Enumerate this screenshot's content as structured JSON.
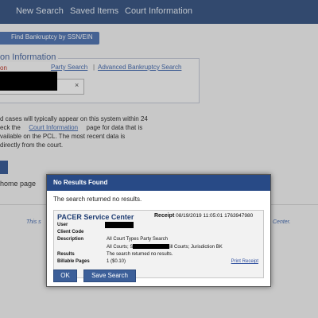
{
  "nav": {
    "items": [
      "New Search",
      "Saved Items",
      "Court Information"
    ]
  },
  "subbar": {
    "label": "Find Bankruptcy by SSN/EIN"
  },
  "panel": {
    "title": "on Information",
    "red_label": "on",
    "party_search": "Party Search",
    "separator": "|",
    "advanced_search": "Advanced Bankruptcy Search",
    "clear": "×"
  },
  "info": {
    "line1": "d cases will typically appear on this system within 24",
    "line2_pre": "eck the",
    "court_info": "Court Information",
    "line2_post": "page for data that is",
    "line3": "vailable on the PCL. The most recent data is",
    "line4": "directly from the court."
  },
  "home": "home page",
  "footer": {
    "left": "This s",
    "right": "Center."
  },
  "modal": {
    "title": "No Results Found",
    "message": "The search returned no results.",
    "receipt": {
      "center": "PACER Service Center",
      "receipt_label": "Receipt",
      "datetime": "08/19/2019 11:05:01",
      "number": "1763947980",
      "user_label": "User",
      "client_code_label": "Client Code",
      "description_label": "Description",
      "description": "All Court Types Party Search",
      "description_line2_pre": "All Courts; S",
      "description_line2_post": "ill Courts; Jurisdiction BK",
      "results_label": "Results",
      "results": "The search returned no results.",
      "billable_label": "Billable Pages",
      "billable": "1 ($0.10)",
      "print": "Print Receipt"
    },
    "ok": "OK",
    "save_search": "Save Search"
  }
}
